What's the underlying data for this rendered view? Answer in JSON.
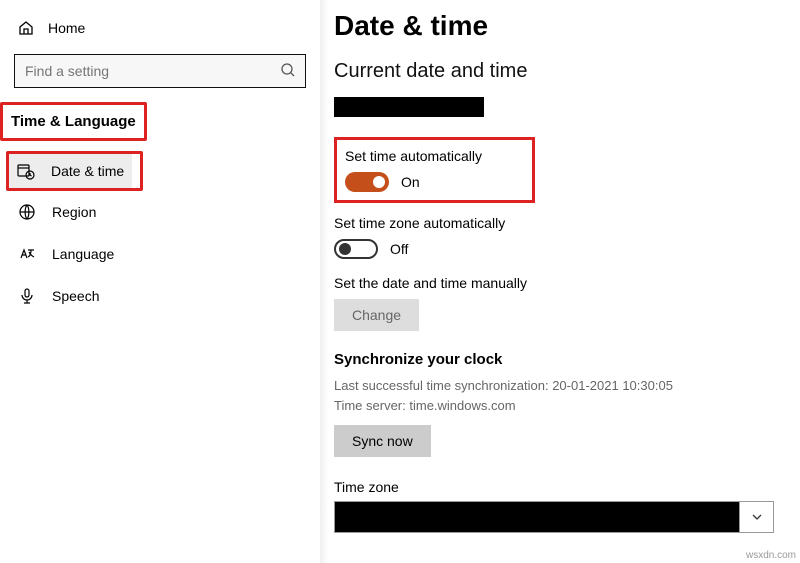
{
  "sidebar": {
    "home_label": "Home",
    "search_placeholder": "Find a setting",
    "category_label": "Time & Language",
    "items": [
      {
        "label": "Date & time"
      },
      {
        "label": "Region"
      },
      {
        "label": "Language"
      },
      {
        "label": "Speech"
      }
    ]
  },
  "content": {
    "page_title": "Date & time",
    "section_current": "Current date and time",
    "set_time_auto_label": "Set time automatically",
    "set_time_auto_state": "On",
    "set_tz_auto_label": "Set time zone automatically",
    "set_tz_auto_state": "Off",
    "set_manual_label": "Set the date and time manually",
    "change_btn": "Change",
    "sync_heading": "Synchronize your clock",
    "sync_last": "Last successful time synchronization: 20-01-2021 10:30:05",
    "sync_server": "Time server: time.windows.com",
    "sync_btn": "Sync now",
    "tz_label": "Time zone"
  },
  "watermark": "wsxdn.com"
}
